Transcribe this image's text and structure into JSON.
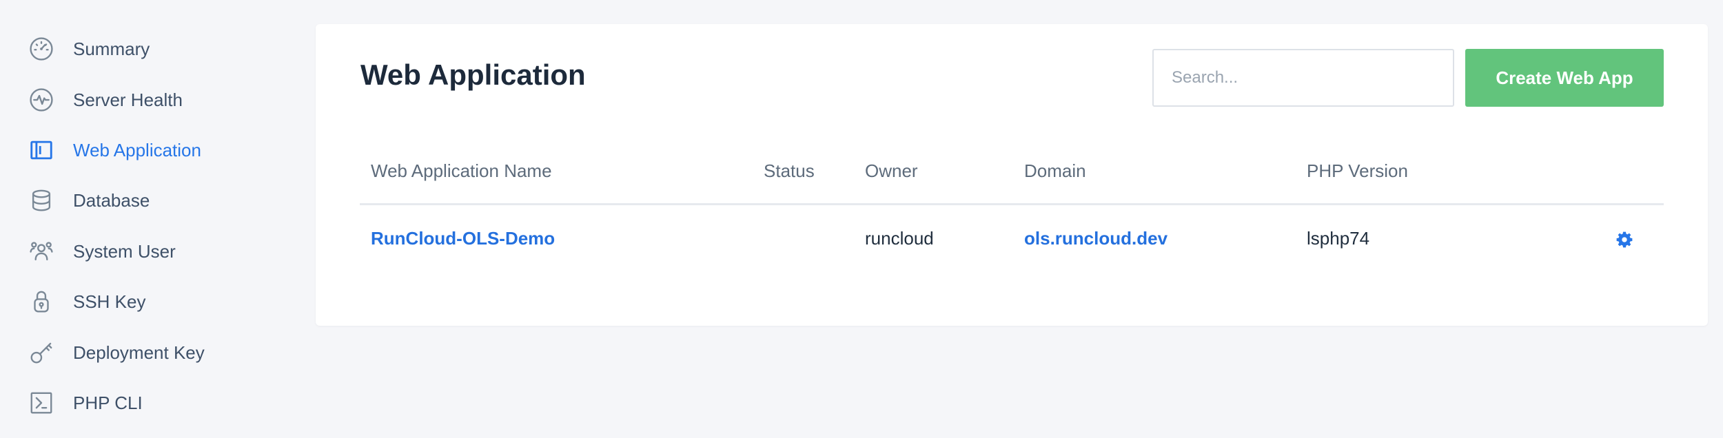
{
  "sidebar": {
    "items": [
      {
        "label": "Summary",
        "icon": "gauge-icon",
        "active": false
      },
      {
        "label": "Server Health",
        "icon": "heartbeat-icon",
        "active": false
      },
      {
        "label": "Web Application",
        "icon": "browser-window-icon",
        "active": true
      },
      {
        "label": "Database",
        "icon": "database-icon",
        "active": false
      },
      {
        "label": "System User",
        "icon": "users-icon",
        "active": false
      },
      {
        "label": "SSH Key",
        "icon": "lock-icon",
        "active": false
      },
      {
        "label": "Deployment Key",
        "icon": "key-icon",
        "active": false
      },
      {
        "label": "PHP CLI",
        "icon": "terminal-icon",
        "active": false
      }
    ]
  },
  "main": {
    "title": "Web Application",
    "search": {
      "placeholder": "Search...",
      "value": ""
    },
    "create_button_label": "Create Web App",
    "table": {
      "columns": [
        "Web Application Name",
        "Status",
        "Owner",
        "Domain",
        "PHP Version"
      ],
      "rows": [
        {
          "name": "RunCloud-OLS-Demo",
          "status": "",
          "owner": "runcloud",
          "domain": "ols.runcloud.dev",
          "php_version": "lsphp74",
          "action_icon": "gear-icon"
        }
      ]
    }
  },
  "colors": {
    "accent": "#2676e8",
    "primary_button": "#62c47c",
    "background": "#f5f6f9",
    "icon": "#7a8896"
  }
}
